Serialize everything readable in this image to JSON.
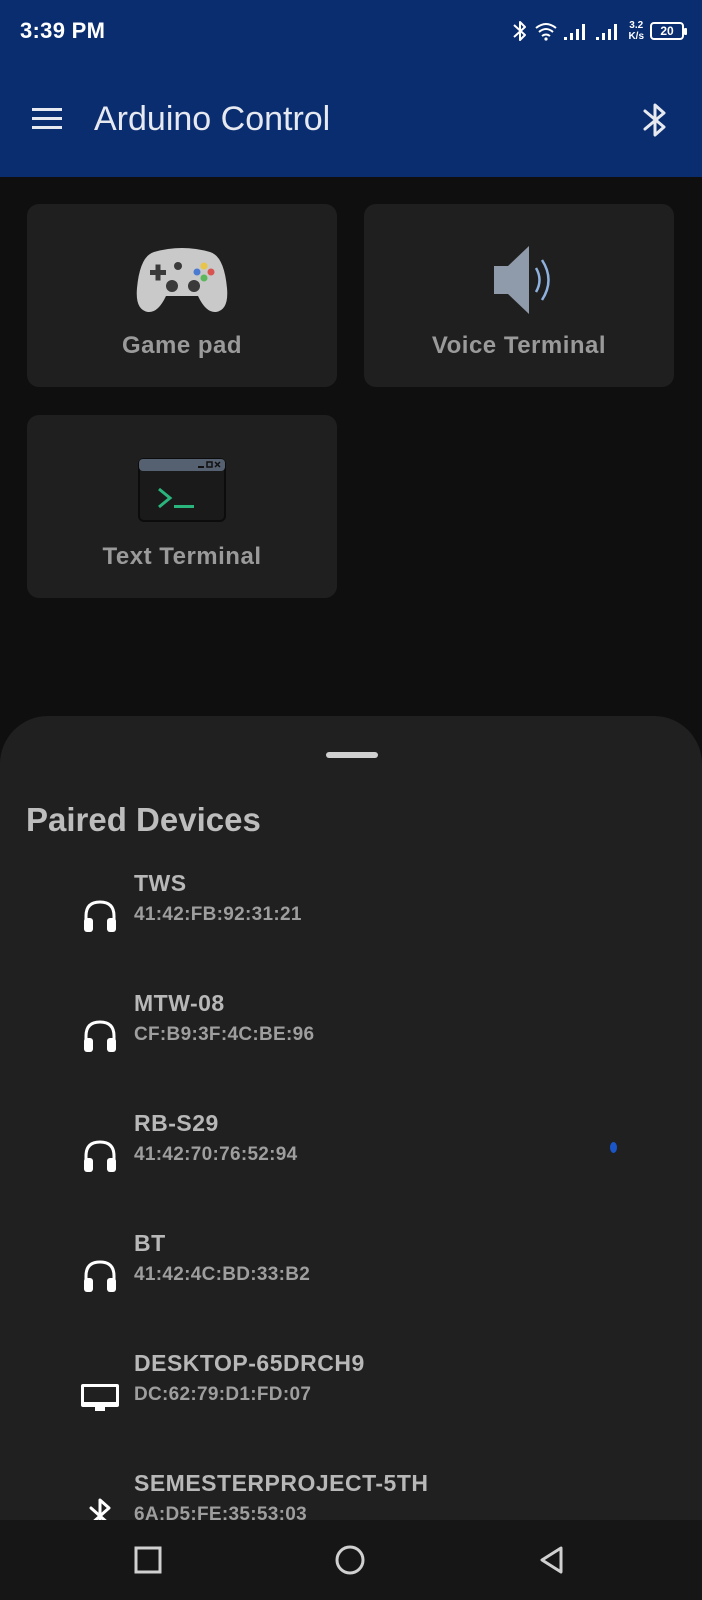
{
  "status_bar": {
    "time": "3:39 PM",
    "net_speed_value": "3.2",
    "net_speed_unit": "K/s",
    "battery": "20",
    "icons": [
      "bluetooth-icon",
      "wifi-icon",
      "signal-icon",
      "signal-icon"
    ]
  },
  "app_bar": {
    "title": "Arduino Control",
    "menu_icon": "hamburger-menu-icon",
    "action_icon": "bluetooth-icon"
  },
  "tiles": [
    {
      "label": "Game pad",
      "icon": "gamepad-icon"
    },
    {
      "label": "Voice Terminal",
      "icon": "speaker-icon"
    },
    {
      "label": "Text Terminal",
      "icon": "terminal-icon"
    }
  ],
  "sheet": {
    "title": "Paired Devices",
    "devices": [
      {
        "name": "TWS",
        "address": "41:42:FB:92:31:21",
        "icon": "headphones-icon"
      },
      {
        "name": "MTW-08",
        "address": "CF:B9:3F:4C:BE:96",
        "icon": "headphones-icon"
      },
      {
        "name": "RB-S29",
        "address": "41:42:70:76:52:94",
        "icon": "headphones-icon"
      },
      {
        "name": "BT",
        "address": "41:42:4C:BD:33:B2",
        "icon": "headphones-icon"
      },
      {
        "name": "DESKTOP-65DRCH9",
        "address": "DC:62:79:D1:FD:07",
        "icon": "monitor-icon"
      },
      {
        "name": "SEMESTERPROJECT-5TH",
        "address": "6A:D5:FE:35:53:03",
        "icon": "bluetooth-icon"
      }
    ]
  },
  "colors": {
    "primary": "#0a2d70",
    "background": "#0f0f0f",
    "surface": "#1f1f1f",
    "sheet": "#202020"
  }
}
